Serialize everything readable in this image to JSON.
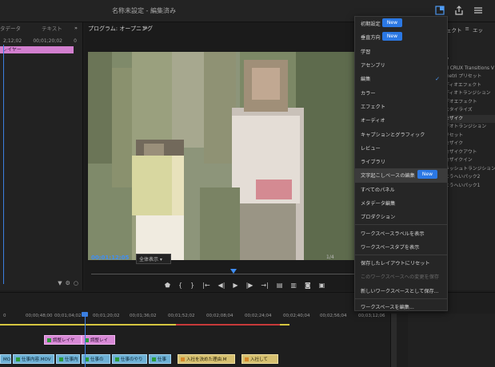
{
  "window": {
    "title": "名称未設定 - 編集済み"
  },
  "left_panel": {
    "tabs": [
      "タデータ",
      "テキスト"
    ],
    "timecode_a": "2;12;02",
    "timecode_b": "00;01;20;02",
    "timecode_c": "0",
    "clip_label": "レイヤー"
  },
  "program": {
    "title": "プログラム: オープニング",
    "timecode": "00;01;12;05",
    "fit_label": "全体表示",
    "ratio": "1/4"
  },
  "workspaces": {
    "items": [
      {
        "label": "初期設定",
        "badge": "New"
      },
      {
        "label": "垂直方向",
        "badge": "New"
      },
      {
        "label": "学習"
      },
      {
        "label": "アセンブリ"
      },
      {
        "label": "編集",
        "checked": true
      },
      {
        "label": "カラー"
      },
      {
        "label": "エフェクト"
      },
      {
        "label": "オーディオ"
      },
      {
        "label": "キャプションとグラフィック"
      },
      {
        "label": "レビュー"
      },
      {
        "label": "ライブラリ"
      },
      {
        "label": "文字起こしベースの編集",
        "badge": "New",
        "highlighted": true
      },
      {
        "label": "すべてのパネル"
      },
      {
        "label": "メタデータ編集"
      },
      {
        "label": "プロダクション"
      }
    ],
    "actions": [
      {
        "label": "ワークスペースラベルを表示"
      },
      {
        "label": "ワークスペースタブを表示"
      },
      {
        "label": "保存したレイアウトにリセット"
      },
      {
        "label": "このワークスペースへの変更を保存",
        "disabled": true
      },
      {
        "label": "新しいワークスペースとして保存..."
      },
      {
        "label": "ワークスペースを編集..."
      }
    ]
  },
  "effects_panel": {
    "tab_label": "ェクト",
    "tab_label2": "エッ",
    "items": [
      "ク",
      "M CRUX Transitions V",
      "metri プリセット",
      "ディオエフェクト",
      "ディオトランジション",
      "デオエフェクト",
      "スタイライズ",
      "モザイク",
      "デオトランジション",
      "リセット",
      "モザイク",
      "モザイクアウト",
      "モザイクイン",
      "ラッシュトランジション",
      "ようへいパック2",
      "ようへいパック1"
    ],
    "selected_index": 7
  },
  "timeline": {
    "ruler": [
      "00;00;48;00",
      "00;01;04;02",
      "00;01;20;02",
      "00;01;36;02",
      "00;01;52;02",
      "00;02;08;04",
      "00;02;24;04",
      "00;02;40;04",
      "00;02;56;04",
      "00;03;12;06",
      "00;03;28"
    ],
    "row0": "0",
    "adjust_clips": [
      "調整レイヤ",
      "調整レイ"
    ],
    "video_clips": [
      "MO",
      "仕事内容.MOV",
      "仕事内",
      "仕事の",
      "仕事のやり",
      "仕事",
      "入社を決めた理由.M",
      "入社して"
    ]
  },
  "colors": {
    "accent": "#2b78e4",
    "adjust": "#d889d6",
    "video": "#6db0d5",
    "audio_yellow": "#d6c070"
  }
}
